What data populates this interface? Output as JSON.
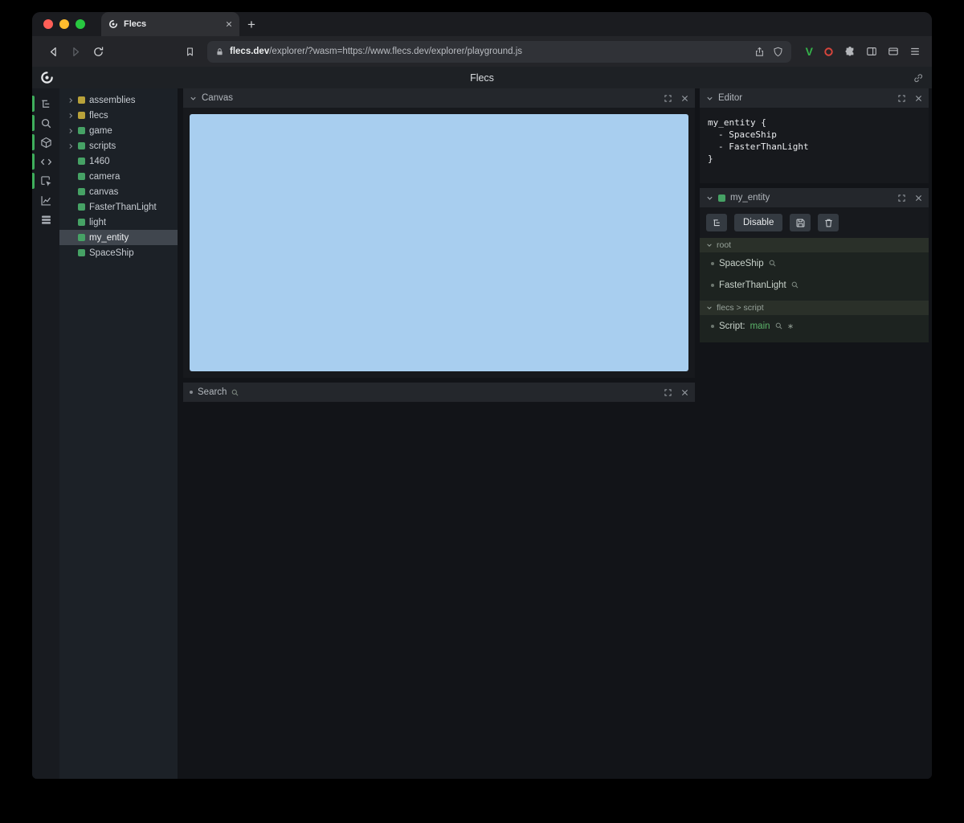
{
  "colors": {
    "module_color": "#b9a23a",
    "entity_color": "#46a265",
    "accent_green": "#3fae5c",
    "canvas_blue": "#a8ceef",
    "script_green": "#5cb46a"
  },
  "browser": {
    "tab_title": "Flecs",
    "new_tab_label": "+",
    "url_host": "flecs.dev",
    "url_rest": "/explorer/?wasm=https://www.flecs.dev/explorer/playground.js",
    "extension_v_label": "V"
  },
  "app": {
    "title": "Flecs"
  },
  "sidebar": {
    "icons": [
      "tree",
      "search",
      "cube",
      "code",
      "inspect",
      "chart",
      "rows"
    ]
  },
  "tree": {
    "items": [
      {
        "label": "assemblies",
        "type": "module",
        "expandable": true
      },
      {
        "label": "flecs",
        "type": "module",
        "expandable": true
      },
      {
        "label": "game",
        "type": "entity",
        "expandable": true
      },
      {
        "label": "scripts",
        "type": "entity",
        "expandable": true
      },
      {
        "label": "1460",
        "type": "entity",
        "expandable": false
      },
      {
        "label": "camera",
        "type": "entity",
        "expandable": false
      },
      {
        "label": "canvas",
        "type": "entity",
        "expandable": false
      },
      {
        "label": "FasterThanLight",
        "type": "entity",
        "expandable": false
      },
      {
        "label": "light",
        "type": "entity",
        "expandable": false
      },
      {
        "label": "my_entity",
        "type": "entity",
        "expandable": false,
        "selected": true
      },
      {
        "label": "SpaceShip",
        "type": "entity",
        "expandable": false
      }
    ]
  },
  "panels": {
    "canvas": {
      "title": "Canvas"
    },
    "search": {
      "title": "Search"
    },
    "editor": {
      "title": "Editor",
      "code": [
        "my_entity {",
        "- SpaceShip",
        "- FasterThanLight",
        "}"
      ]
    },
    "entity": {
      "title": "my_entity",
      "disable_button": "Disable",
      "sections": [
        {
          "title": "root",
          "items": [
            {
              "label": "SpaceShip"
            },
            {
              "label": "FasterThanLight"
            }
          ]
        },
        {
          "title": "flecs > script",
          "items": [
            {
              "prefix": "Script:",
              "value": "main"
            }
          ]
        }
      ]
    }
  }
}
